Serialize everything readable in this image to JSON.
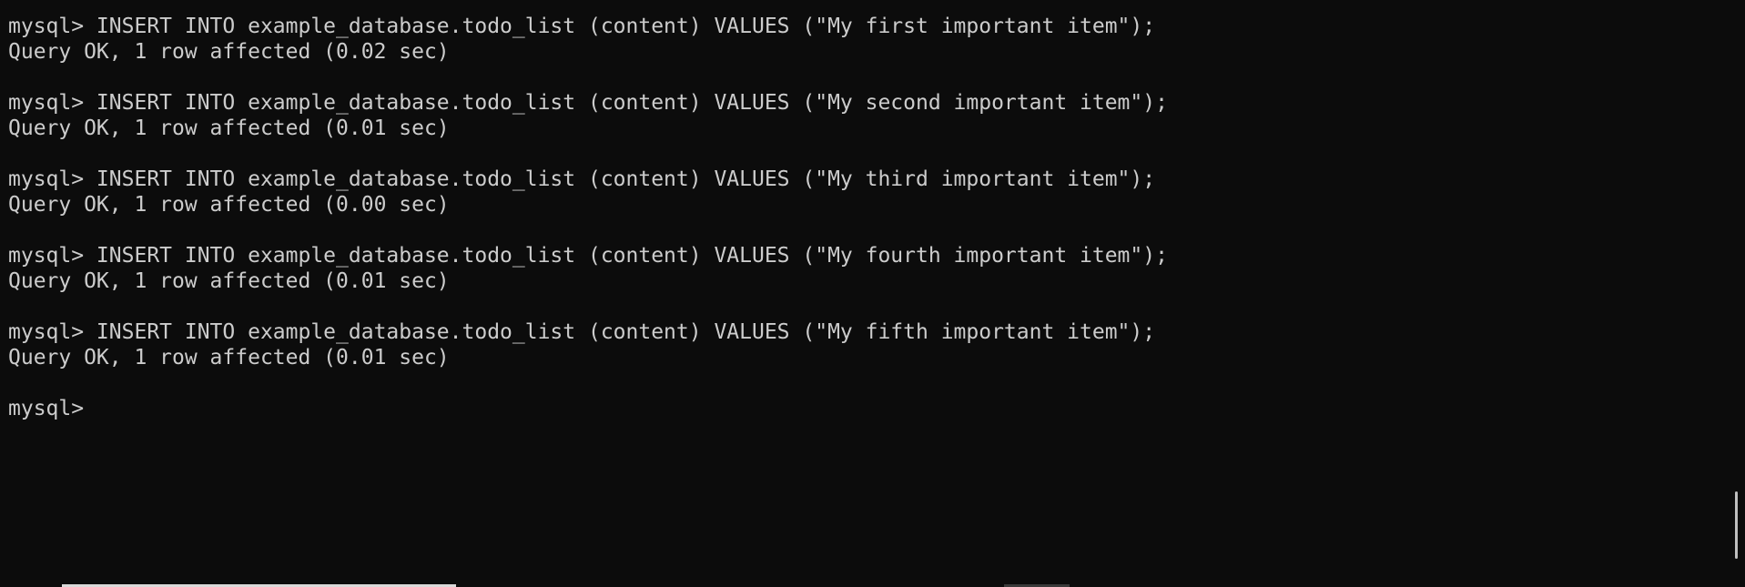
{
  "terminal": {
    "lines": [
      "mysql> INSERT INTO example_database.todo_list (content) VALUES (\"My first important item\");",
      "Query OK, 1 row affected (0.02 sec)",
      "",
      "mysql> INSERT INTO example_database.todo_list (content) VALUES (\"My second important item\");",
      "Query OK, 1 row affected (0.01 sec)",
      "",
      "mysql> INSERT INTO example_database.todo_list (content) VALUES (\"My third important item\");",
      "Query OK, 1 row affected (0.00 sec)",
      "",
      "mysql> INSERT INTO example_database.todo_list (content) VALUES (\"My fourth important item\");",
      "Query OK, 1 row affected (0.01 sec)",
      "",
      "mysql> INSERT INTO example_database.todo_list (content) VALUES (\"My fifth important item\");",
      "Query OK, 1 row affected (0.01 sec)",
      "",
      "mysql> "
    ]
  },
  "colors": {
    "background": "#0c0c0c",
    "text": "#cccccc"
  }
}
